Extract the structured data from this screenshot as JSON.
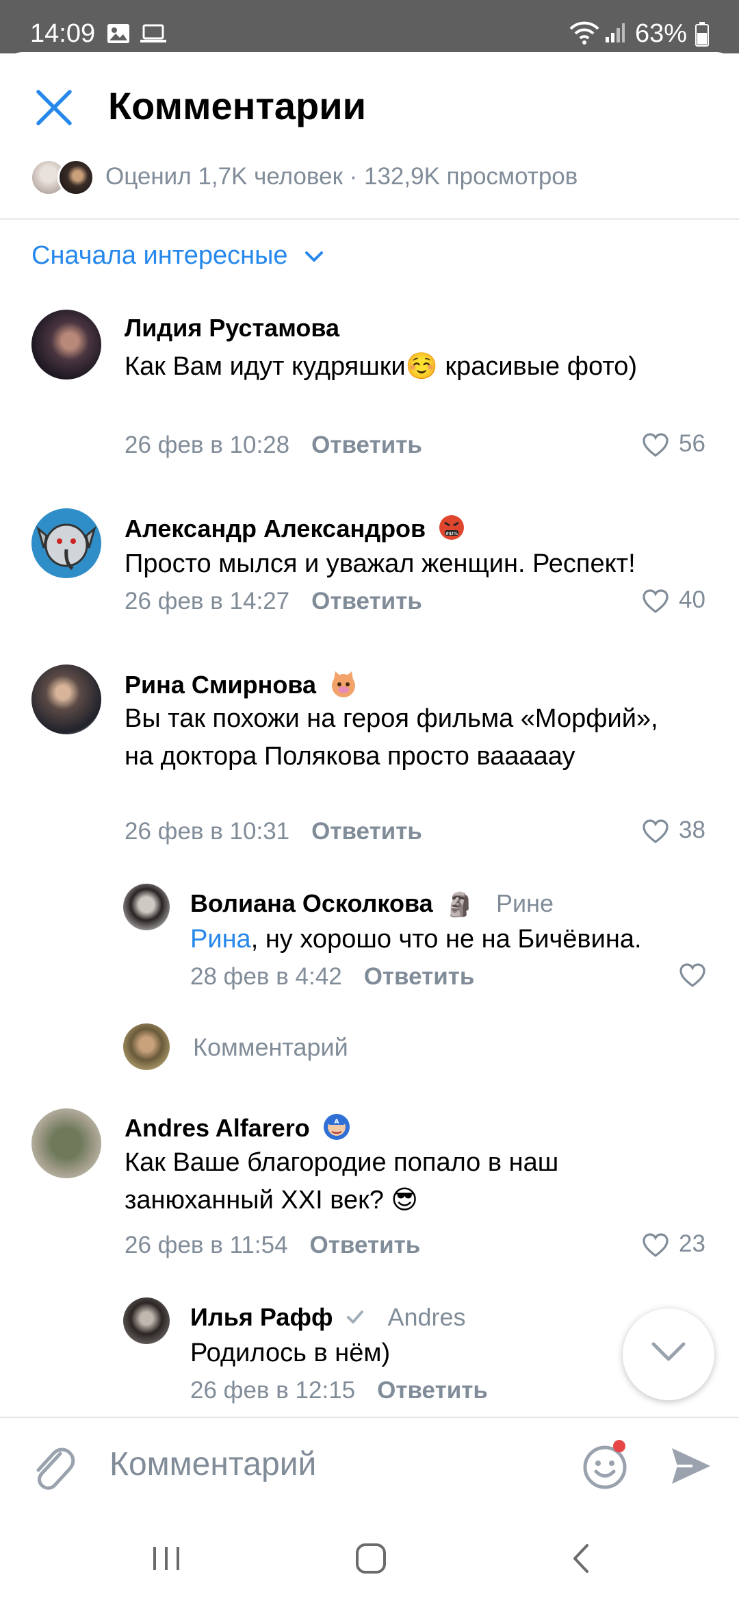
{
  "status_bar": {
    "time": "14:09",
    "battery": "63%"
  },
  "header": {
    "title": "Комментарии",
    "stats": "Оценил 1,7K человек · 132,9K просмотров"
  },
  "sort": {
    "label": "Сначала интересные"
  },
  "comments": [
    {
      "name": "Лидия Рустамова",
      "text": "Как Вам идут кудряшки☺️ красивые фото)",
      "time": "26 фев в 10:28",
      "reply": "Ответить",
      "likes": "56"
    },
    {
      "name": "Александр Александров",
      "text": "Просто мылся и уважал женщин. Респект!",
      "time": "26 фев в 14:27",
      "reply": "Ответить",
      "likes": "40"
    },
    {
      "name": "Рина Смирнова",
      "text": "Вы так похожи на героя фильма «Морфий», на доктора Полякова просто вааааау",
      "time": "26 фев в 10:31",
      "reply": "Ответить",
      "likes": "38"
    },
    {
      "name": "Andres Alfarero",
      "text": "Как Ваше благородие попало в наш занюханный XXI век? 😎",
      "time": "26 фев в 11:54",
      "reply": "Ответить",
      "likes": "23"
    }
  ],
  "replies": [
    {
      "name": "Волиана Осколкова",
      "emoji": "🗿",
      "reply_to": "Рине",
      "mention": "Рина",
      "text": ", ну хорошо что не на Бичёвина.",
      "time": "28 фев в 4:42",
      "reply": "Ответить"
    },
    {
      "name": "Илья Рафф",
      "reply_to": "Andres",
      "text": "Родилось в нём)",
      "time": "26 фев в 12:15",
      "reply": "Ответить"
    }
  ],
  "thread_input": {
    "placeholder": "Комментарий"
  },
  "composer": {
    "placeholder": "Комментарий"
  },
  "colors": {
    "accent": "#2688eb",
    "secondary": "#818c99",
    "notification": "#e64646"
  }
}
